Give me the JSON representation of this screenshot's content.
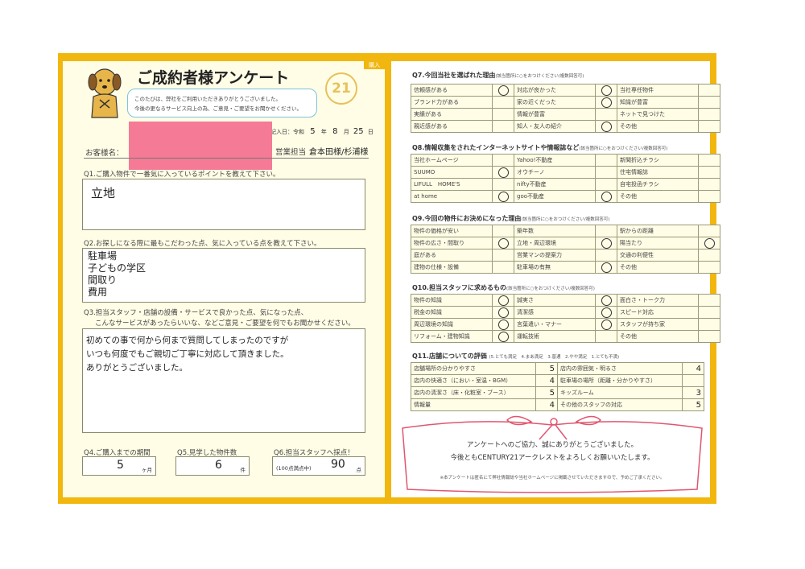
{
  "header": {
    "title": "ご成約者様アンケート",
    "badge": "購入",
    "intro1": "このたびは、弊社をご利用いただきありがとうございました。",
    "intro2": "今後の更なるサービス向上の為、ご意見・ご要望をお聞かせください。",
    "logo_num": "21"
  },
  "info": {
    "date_label": "記入日：令和",
    "year": "5",
    "year_unit": "年",
    "month": "8",
    "month_unit": "月",
    "day": "25",
    "day_unit": "日",
    "customer_label": "お客様名：",
    "sales_label": "営業担当",
    "sales_value": "倉本田様/杉浦様"
  },
  "q1": {
    "label": "Q1.ご購入物件で一番気に入っているポイントを教えて下さい。",
    "answer": "立地"
  },
  "q2": {
    "label": "Q2.お探しになる際に最もこだわった点、気に入っている点を教えて下さい。",
    "answer": [
      "駐車場",
      "子どもの学区",
      "間取り",
      "費用"
    ]
  },
  "q3": {
    "label1": "Q3.担当スタッフ・店舗の設備・サービスで良かった点、気になった点、",
    "label2": "こんなサービスがあったらいいな、などご意見・ご要望を何でもお聞かせください。",
    "answer": [
      "初めての事で何から何まで質問してしまったのですが",
      "いつも何度でもご親切ご丁寧に対応して頂きました。",
      "ありがとうございました。"
    ]
  },
  "q4": {
    "label": "Q4.ご購入までの期間",
    "value": "5",
    "unit": "ヶ月"
  },
  "q5": {
    "label": "Q5.見学した物件数",
    "value": "6",
    "unit": "件"
  },
  "q6": {
    "label": "Q6.担当スタッフへ採点！",
    "note": "(100点満点中)",
    "value": "90",
    "unit": "点"
  },
  "q7": {
    "label": "Q7.今回当社を選ばれた理由",
    "note": "(該当箇所に○をおつけください/複数回答可)",
    "rows": [
      [
        {
          "t": "信頼感がある",
          "c": true
        },
        {
          "t": "対応が良かった",
          "c": true
        },
        {
          "t": "当社専任物件",
          "c": false
        }
      ],
      [
        {
          "t": "ブランド力がある",
          "c": false
        },
        {
          "t": "家の近くだった",
          "c": true
        },
        {
          "t": "知識が豊富",
          "c": false
        }
      ],
      [
        {
          "t": "実績がある",
          "c": false
        },
        {
          "t": "情報が豊富",
          "c": false
        },
        {
          "t": "ネットで見つけた",
          "c": false
        }
      ],
      [
        {
          "t": "親近感がある",
          "c": false
        },
        {
          "t": "知人・友人の紹介",
          "c": true
        },
        {
          "t": "その他",
          "c": false
        }
      ]
    ]
  },
  "q8": {
    "label": "Q8.情報収集をされたインターネットサイトや情報誌など",
    "note": "(該当箇所に○をおつけください/複数回答可)",
    "rows": [
      [
        {
          "t": "当社ホームページ",
          "c": false
        },
        {
          "t": "Yahoo!不動産",
          "c": false
        },
        {
          "t": "新聞折込チラシ",
          "c": false
        }
      ],
      [
        {
          "t": "SUUMO",
          "c": true
        },
        {
          "t": "オウチーノ",
          "c": false
        },
        {
          "t": "住宅情報誌",
          "c": false
        }
      ],
      [
        {
          "t": "LIFULL　HOME'S",
          "c": false
        },
        {
          "t": "nifty不動産",
          "c": false
        },
        {
          "t": "自宅投函チラシ",
          "c": false
        }
      ],
      [
        {
          "t": "at home",
          "c": true
        },
        {
          "t": "goo不動産",
          "c": true
        },
        {
          "t": "その他",
          "c": false
        }
      ]
    ]
  },
  "q9": {
    "label": "Q9.今回の物件にお決めになった理由",
    "note": "(該当箇所に○をおつけください/複数回答可)",
    "rows": [
      [
        {
          "t": "物件の価格が安い",
          "c": false
        },
        {
          "t": "築年数",
          "c": false
        },
        {
          "t": "駅からの距離",
          "c": false
        }
      ],
      [
        {
          "t": "物件の広さ・間取り",
          "c": true
        },
        {
          "t": "立地・周辺環境",
          "c": true
        },
        {
          "t": "陽当たり",
          "c": true
        }
      ],
      [
        {
          "t": "庭がある",
          "c": false
        },
        {
          "t": "営業マンの提案力",
          "c": false
        },
        {
          "t": "交通の利便性",
          "c": false
        }
      ],
      [
        {
          "t": "建物の仕様・設備",
          "c": false
        },
        {
          "t": "駐車場の有無",
          "c": true
        },
        {
          "t": "その他",
          "c": false
        }
      ]
    ]
  },
  "q10": {
    "label": "Q10.担当スタッフに求めるもの",
    "note": "(該当箇所に○をおつけください/複数回答可)",
    "rows": [
      [
        {
          "t": "物件の知識",
          "c": true
        },
        {
          "t": "誠実さ",
          "c": true
        },
        {
          "t": "面白さ・トーク力",
          "c": false
        }
      ],
      [
        {
          "t": "税金の知識",
          "c": true
        },
        {
          "t": "清潔感",
          "c": true
        },
        {
          "t": "スピード対応",
          "c": false
        }
      ],
      [
        {
          "t": "周辺環境の知識",
          "c": true
        },
        {
          "t": "言葉遣い・マナー",
          "c": true
        },
        {
          "t": "スタッフが持ち家",
          "c": false
        }
      ],
      [
        {
          "t": "リフォーム・建物知識",
          "c": true
        },
        {
          "t": "運転技術",
          "c": false
        },
        {
          "t": "その他",
          "c": false
        }
      ]
    ]
  },
  "q11": {
    "label": "Q11.店舗についての評価",
    "scale": "(5.とても満足　4.まあ満足　3.普通　2.やや満足　1.とても不満)",
    "rows": [
      [
        {
          "t": "店舗場所の分かりやすさ",
          "v": "5"
        },
        {
          "t": "店内の雰囲気・明るさ",
          "v": "4"
        }
      ],
      [
        {
          "t": "店内の快適さ（におい・室温・BGM）",
          "v": "4"
        },
        {
          "t": "駐車場の場所（距離・分かりやすさ）",
          "v": ""
        }
      ],
      [
        {
          "t": "店内の清潔さ（床・化粧室・ブース）",
          "v": "5"
        },
        {
          "t": "キッズルーム",
          "v": "3"
        }
      ],
      [
        {
          "t": "情報量",
          "v": "4"
        },
        {
          "t": "その他のスタッフの対応",
          "v": "5"
        }
      ]
    ]
  },
  "thanks": {
    "line1": "アンケートへのご協力、誠にありがとうございました。",
    "line2": "今後ともCENTURY21アークレストをよろしくお願いいたします。",
    "footnote": "※本アンケートは匿名にて弊社情報誌や当社ホームページに掲載させていただきますので、予めご了承ください。"
  }
}
